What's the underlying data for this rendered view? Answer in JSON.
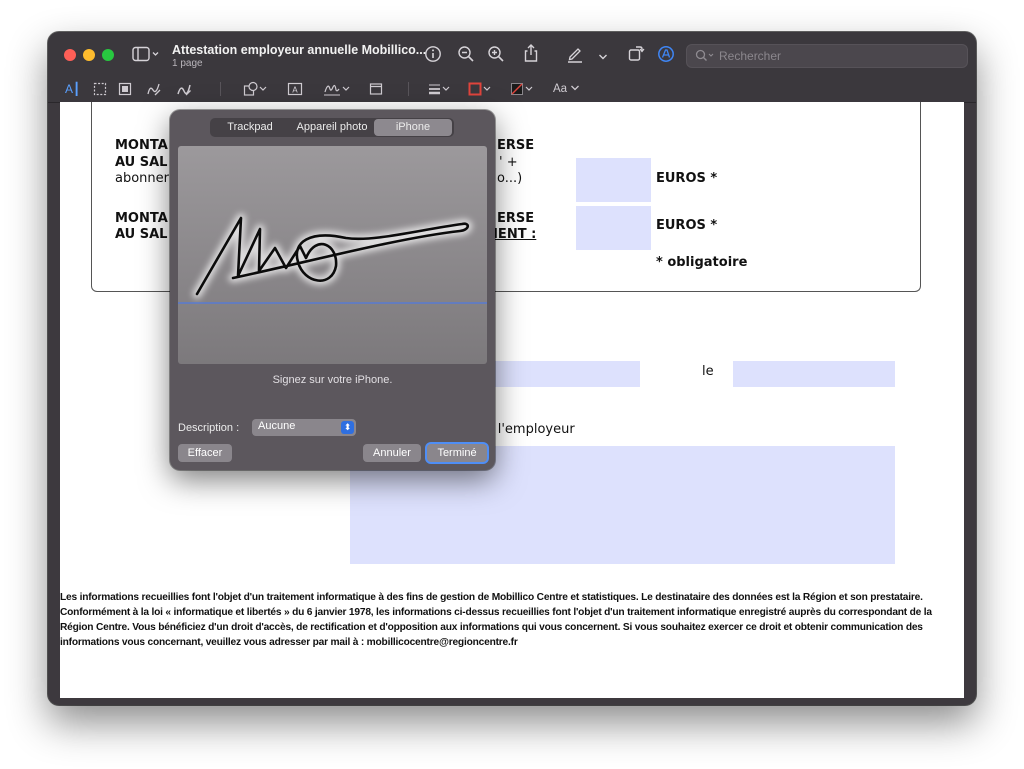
{
  "window": {
    "title": "Attestation employeur annuelle Mobillico...",
    "subtitle": "1 page"
  },
  "titlebar": {
    "search_placeholder": "Rechercher"
  },
  "toolbar": {
    "text_style_label": "Aa"
  },
  "document": {
    "row1_label_a": "MONTA",
    "row1_label_b": "AU SAL",
    "row1_label_c": "abonner",
    "row1_right_a": "ERSE",
    "row1_right_b": "' +",
    "row1_right_c": "o...)",
    "row1_unit": "EUROS *",
    "row2_label_a": "MONTA",
    "row2_label_b": "AU SAL",
    "row2_right_a": "ERSE",
    "row2_right_b": "MENT :",
    "row2_unit": "EUROS *",
    "mandatory_note": "* obligatoire",
    "date_label": "le",
    "employer_label": "le l'employeur",
    "legal_text": "Les informations recueillies font l'objet d'un traitement informatique à des fins de gestion de Mobillico Centre et statistiques. Le destinataire des données est la Région et son prestataire. Conformément à la loi « informatique et libertés » du 6 janvier 1978, les informations ci-dessus recueillies font l'objet d'un traitement informatique enregistré auprès du correspondant de la Région Centre. Vous bénéficiez d'un droit d'accès, de rectification et d'opposition aux informations qui vous concernent. Si vous souhaitez exercer ce droit et obtenir communication des informations vous concernant, veuillez vous adresser par mail à : mobillicocentre@regioncentre.fr"
  },
  "signature_popover": {
    "tabs": [
      {
        "label": "Trackpad",
        "selected": false
      },
      {
        "label": "Appareil photo",
        "selected": false
      },
      {
        "label": "iPhone",
        "selected": true
      }
    ],
    "hint": "Signez sur votre iPhone.",
    "description_label": "Description :",
    "description_value": "Aucune",
    "clear_label": "Effacer",
    "cancel_label": "Annuler",
    "done_label": "Terminé"
  },
  "colors": {
    "accent": "#2f6fe0",
    "field_fill": "#dde1fd",
    "traffic_close": "#fe5f57",
    "traffic_minimize": "#febc2e",
    "traffic_zoom": "#28c840"
  }
}
